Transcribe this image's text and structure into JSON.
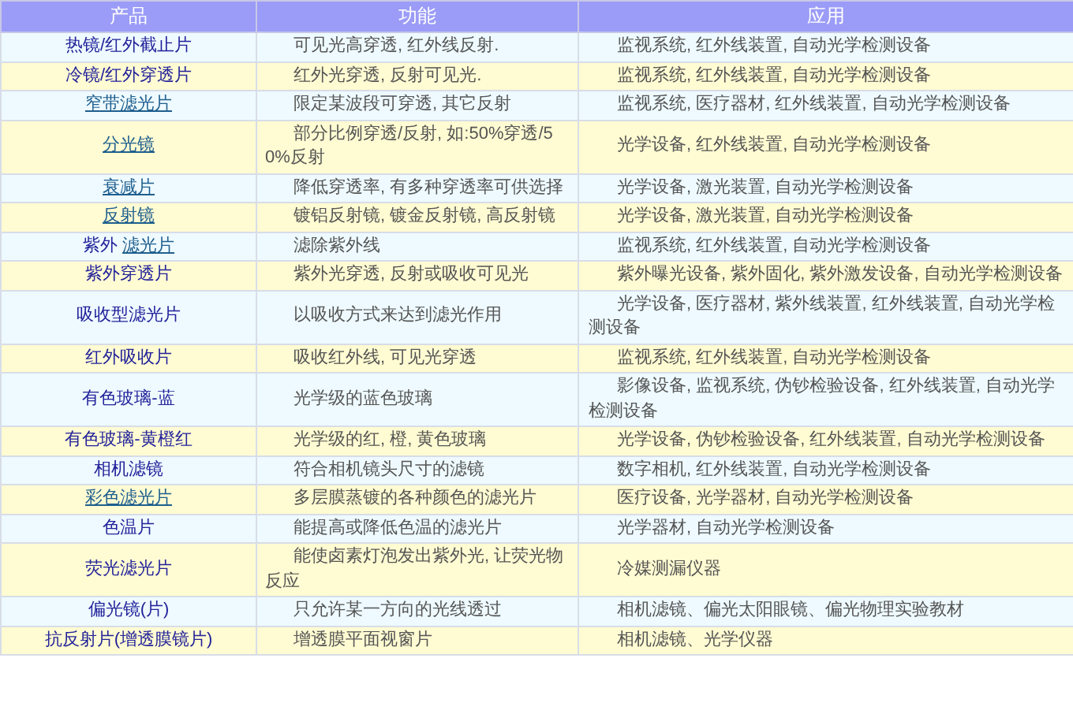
{
  "table": {
    "columns": [
      "产品",
      "功能",
      "应用"
    ],
    "rows": [
      {
        "product": [
          {
            "text": "热镜/红外截止片",
            "link": false
          }
        ],
        "function": "可见光高穿透, 红外线反射.",
        "application": "监视系统, 红外线装置, 自动光学检测设备"
      },
      {
        "product": [
          {
            "text": "冷镜/红外穿透片",
            "link": false
          }
        ],
        "function": "红外光穿透, 反射可见光.",
        "application": "监视系统, 红外线装置, 自动光学检测设备"
      },
      {
        "product": [
          {
            "text": "窄带滤光片",
            "link": true
          }
        ],
        "function": "限定某波段可穿透, 其它反射",
        "application": "监视系统, 医疗器材, 红外线装置, 自动光学检测设备"
      },
      {
        "product": [
          {
            "text": "分光镜",
            "link": true
          }
        ],
        "function": "部分比例穿透/反射, 如:50%穿透/50%反射",
        "application": "光学设备, 红外线装置, 自动光学检测设备"
      },
      {
        "product": [
          {
            "text": "衰减片",
            "link": true
          }
        ],
        "function": "降低穿透率, 有多种穿透率可供选择",
        "application": "光学设备, 激光装置, 自动光学检测设备"
      },
      {
        "product": [
          {
            "text": "反射镜",
            "link": true
          }
        ],
        "function": "镀铝反射镜, 镀金反射镜, 高反射镜",
        "application": "光学设备, 激光装置, 自动光学检测设备"
      },
      {
        "product": [
          {
            "text": "紫外 ",
            "link": false
          },
          {
            "text": "滤光片",
            "link": true
          }
        ],
        "function": "滤除紫外线",
        "application": "监视系统, 红外线装置, 自动光学检测设备"
      },
      {
        "product": [
          {
            "text": "紫外穿透片",
            "link": false
          }
        ],
        "function": "紫外光穿透, 反射或吸收可见光",
        "application": "紫外曝光设备, 紫外固化, 紫外激发设备, 自动光学检测设备"
      },
      {
        "product": [
          {
            "text": "吸收型滤光片",
            "link": false
          }
        ],
        "function": "以吸收方式来达到滤光作用",
        "application": "光学设备, 医疗器材, 紫外线装置, 红外线装置, 自动光学检测设备"
      },
      {
        "product": [
          {
            "text": "红外吸收片",
            "link": false
          }
        ],
        "function": "吸收红外线, 可见光穿透",
        "application": "监视系统, 红外线装置, 自动光学检测设备"
      },
      {
        "product": [
          {
            "text": "有色玻璃-蓝",
            "link": false
          }
        ],
        "function": "光学级的蓝色玻璃",
        "application": "影像设备, 监视系统, 伪钞检验设备, 红外线装置, 自动光学检测设备"
      },
      {
        "product": [
          {
            "text": "有色玻璃-黄橙红",
            "link": false
          }
        ],
        "function": "光学级的红, 橙, 黄色玻璃",
        "application": "光学设备, 伪钞检验设备, 红外线装置, 自动光学检测设备"
      },
      {
        "product": [
          {
            "text": "相机滤镜",
            "link": false
          }
        ],
        "function": "符合相机镜头尺寸的滤镜",
        "application": "数字相机, 红外线装置, 自动光学检测设备"
      },
      {
        "product": [
          {
            "text": "彩色滤光片",
            "link": true
          }
        ],
        "function": "多层膜蒸镀的各种颜色的滤光片",
        "application": "医疗设备, 光学器材, 自动光学检测设备"
      },
      {
        "product": [
          {
            "text": "色温片",
            "link": false
          }
        ],
        "function": "能提高或降低色温的滤光片",
        "application": "光学器材, 自动光学检测设备"
      },
      {
        "product": [
          {
            "text": "荧光滤光片",
            "link": false
          }
        ],
        "function": "能使卤素灯泡发出紫外光, 让荧光物反应",
        "application": "冷媒测漏仪器"
      },
      {
        "product": [
          {
            "text": "偏光镜(片)",
            "link": false
          }
        ],
        "function": "只允许某一方向的光线透过",
        "application": "相机滤镜、偏光太阳眼镜、偏光物理实验教材"
      },
      {
        "product": [
          {
            "text": "抗反射片(增透膜镜片)",
            "link": false
          }
        ],
        "function": "增透膜平面视窗片",
        "application": "相机滤镜、光学仪器"
      }
    ]
  }
}
